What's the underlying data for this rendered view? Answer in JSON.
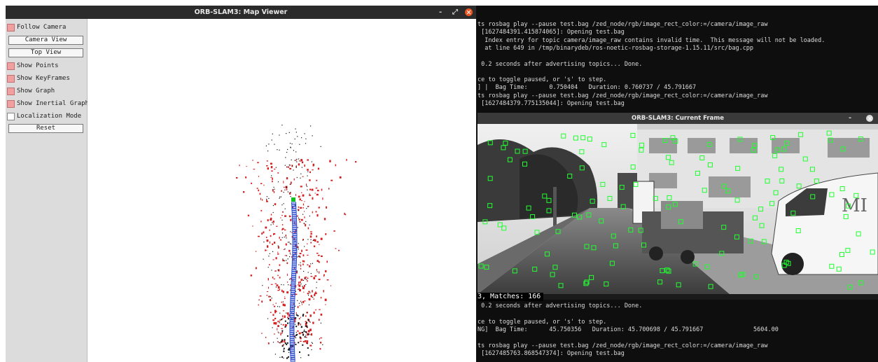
{
  "map_viewer": {
    "title": "ORB-SLAM3: Map Viewer",
    "controls": {
      "minimize": "-",
      "maximize": "⤢"
    },
    "panel": {
      "follow_camera": {
        "label": "Follow Camera",
        "checked": true
      },
      "camera_view_button": "Camera View",
      "top_view_button": "Top View",
      "show_points": {
        "label": "Show Points",
        "checked": true
      },
      "show_keyframes": {
        "label": "Show KeyFrames",
        "checked": true
      },
      "show_graph": {
        "label": "Show Graph",
        "checked": true
      },
      "show_inertial_graph": {
        "label": "Show Inertial Graph",
        "checked": true
      },
      "localization_mode": {
        "label": "Localization Mode",
        "checked": false
      },
      "reset_button": "Reset"
    }
  },
  "terminal": {
    "lines": [
      "ts rosbag play --pause test.bag /zed_node/rgb/image_rect_color:=/camera/image_raw",
      " [1627484391.415874065]: Opening test.bag",
      "  Index entry for topic camera/image_raw contains invalid time.  This message will not be loaded.",
      "  at line 649 in /tmp/binarydeb/ros-noetic-rosbag-storage-1.15.11/src/bag.cpp",
      "",
      " 0.2 seconds after advertising topics... Done.",
      "",
      "ce to toggle paused, or 's' to step.",
      "] |  Bag Time:      0.750404   Duration: 0.760737 / 45.791667",
      "ts rosbag play --pause test.bag /zed_node/rgb/image_rect_color:=/camera/image_raw",
      " [1627484379.775135044]: Opening test.bag"
    ],
    "lines_bottom": [
      " 0.2 seconds after advertising topics... Done.",
      "",
      "ce to toggle paused, or 's' to step.",
      "NG]  Bag Time:      45.750356   Duration: 45.700698 / 45.791667              5604.00",
      "",
      "ts rosbag play --pause test.bag /zed_node/rgb/image_rect_color:=/camera/image_raw",
      " [1627485763.868547374]: Opening test.bag"
    ]
  },
  "current_frame": {
    "title": "ORB-SLAM3: Current Frame",
    "status_text": "3, Matches: 166",
    "minimize": "-"
  },
  "colors": {
    "map_points": "#d42020",
    "reference_points": "#111111",
    "keyframes": "#3050d0",
    "feature_boxes": "#20ff30",
    "close_button": "#e95420"
  }
}
